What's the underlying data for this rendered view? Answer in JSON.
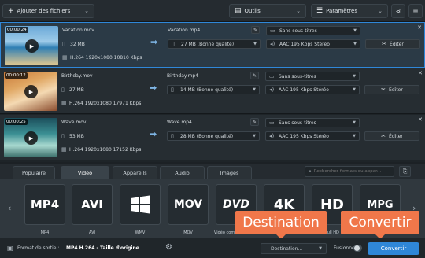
{
  "toolbar": {
    "add_files": "Ajouter des fichiers",
    "tools": "Outils",
    "settings": "Paramètres"
  },
  "files": [
    {
      "duration": "00:00:24",
      "source_name": "Vacation.mov",
      "source_size": "32 MB",
      "source_info": "H.264 1920x1080 10810 Kbps",
      "output_name": "Vacation.mp4",
      "output_size": "27 MB (Bonne qualité)",
      "subtitles": "Sans sous-titres",
      "audio": "AAC 195 Kbps Stéréo",
      "edit": "Éditer"
    },
    {
      "duration": "00:00:12",
      "source_name": "Birthday.mov",
      "source_size": "27 MB",
      "source_info": "H.264 1920x1080 17971 Kbps",
      "output_name": "Birthday.mp4",
      "output_size": "14 MB (Bonne qualité)",
      "subtitles": "Sans sous-titres",
      "audio": "AAC 195 Kbps Stéréo",
      "edit": "Éditer"
    },
    {
      "duration": "00:00:25",
      "source_name": "Wave.mov",
      "source_size": "53 MB",
      "source_info": "H.264 1920x1080 17152 Kbps",
      "output_name": "Wave.mp4",
      "output_size": "28 MB (Bonne qualité)",
      "subtitles": "Sans sous-titres",
      "audio": "AAC 195 Kbps Stéréo",
      "edit": "Éditer"
    }
  ],
  "tabs": [
    "Populaire",
    "Vidéo",
    "Appareils",
    "Audio",
    "Images"
  ],
  "search": {
    "placeholder": "Rechercher formats ou appar..."
  },
  "presets": [
    {
      "logo": "MP4",
      "label": "MP4"
    },
    {
      "logo": "AVI",
      "label": "AVI"
    },
    {
      "logo": "",
      "label": "WMV"
    },
    {
      "logo": "MOV",
      "label": "MOV"
    },
    {
      "logo": "DVD",
      "label": "Vidéo compatible DVD"
    },
    {
      "logo": "4K",
      "label": ""
    },
    {
      "logo": "HD",
      "label": "Full HD"
    },
    {
      "logo": "MPG",
      "label": ""
    }
  ],
  "bottom": {
    "format_label": "Format de sortie :",
    "format_value": "MP4 H.264 - Taille d'origine",
    "destination": "Destination...",
    "merge": "Fusionner :",
    "convert": "Convertir"
  },
  "callouts": {
    "destination": "Destination",
    "convert": "Convertir"
  },
  "colors": {
    "accent": "#2f87d8",
    "callout": "#f0774a"
  }
}
